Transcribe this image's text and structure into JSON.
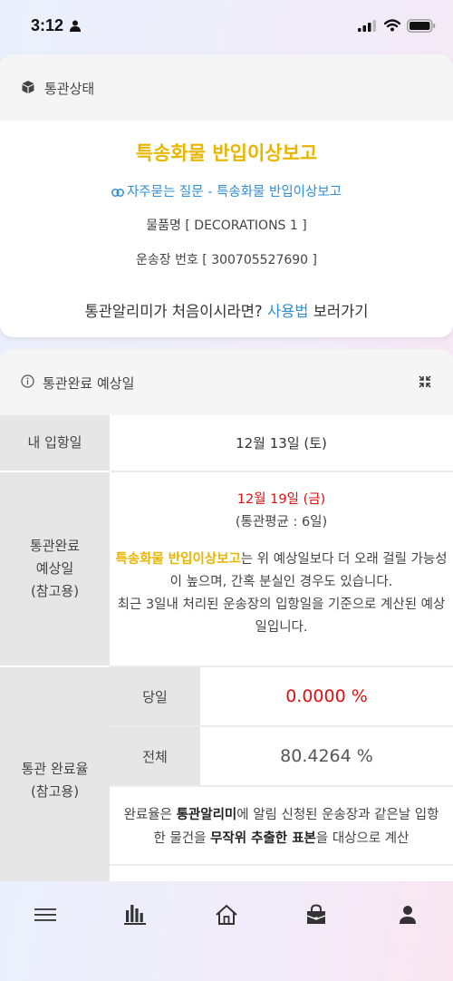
{
  "status_bar": {
    "time": "3:12"
  },
  "status_card": {
    "header_title": "통관상태",
    "report_title": "특송화물 반입이상보고",
    "faq_link": "자주묻는 질문 - 특송화물 반입이상보고",
    "item_name": "물품명 [ DECORATIONS 1 ]",
    "tracking_number": "운송장 번호 [ 300705527690 ]",
    "guide_prefix": "통관알리미가 처음이시라면?",
    "guide_link": "사용법",
    "guide_suffix": "보러가기"
  },
  "estimate_card": {
    "header_title": "통관완료 예상일",
    "arrival_label": "내 입항일",
    "arrival_value": "12월 13일 (토)",
    "expected_label_1": "통관완료",
    "expected_label_2": "예상일",
    "expected_label_3": "(참고용)",
    "expected_date": "12월 19일 (금)",
    "average": "(통관평균 : 6일)",
    "note_highlight": "특송화물 반입이상보고",
    "note_line1_rest": "는 위 예상일보다 더 오래 걸릴 가능성이 높으며, 간혹 분실인 경우도 있습니다.",
    "note_line2": "최근 3일내 처리된 운송장의 입항일을 기준으로 계산된 예상일입니다.",
    "rate_label_1": "통관 완료율",
    "rate_label_2": "(참고용)",
    "same_day_label": "당일",
    "same_day_value": "0.0000 %",
    "total_label": "전체",
    "total_value": "80.4264 %",
    "rate_note_1": "완료율은",
    "rate_note_bold1": "통관알리미",
    "rate_note_2": "에 알림 신청된 운송장과 같은날 입항한 물건을",
    "rate_note_bold2": "무작위 추출한 표본",
    "rate_note_3": "을 대상으로 계산"
  },
  "bottom_nav": {
    "items": [
      "menu-icon",
      "chart-icon",
      "home-icon",
      "bag-icon",
      "user-icon"
    ]
  },
  "colors": {
    "accent_yellow": "#e8b600",
    "link_blue": "#2f8fd5",
    "alert_red": "#dd1111"
  }
}
